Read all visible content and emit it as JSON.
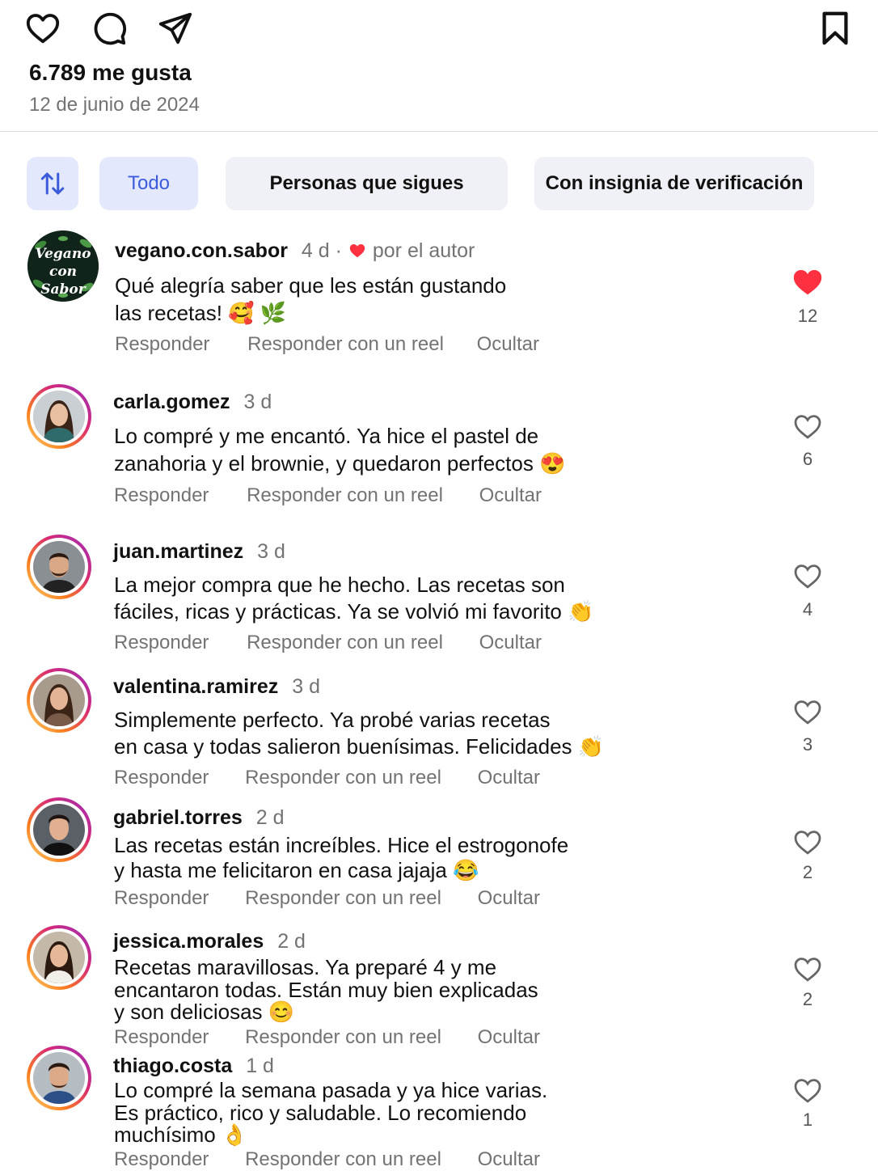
{
  "post": {
    "likes_text": "6.789 me gusta",
    "date_text": "12 de junio de 2024"
  },
  "icons": {
    "like": "heart-icon",
    "comment": "comment-icon",
    "share": "send-icon",
    "save": "bookmark-icon",
    "sort": "sort-arrows-icon"
  },
  "filters": [
    {
      "label": "Todo",
      "active": true
    },
    {
      "label": "Personas que sigues",
      "active": false
    },
    {
      "label": "Con insignia de verificación",
      "active": false
    }
  ],
  "action_labels": {
    "reply": "Responder",
    "reply_reel": "Responder con un reel",
    "hide": "Ocultar"
  },
  "colors": {
    "accent": "#3b5bdb",
    "liked_heart": "#ff3040",
    "muted_text": "#737373"
  },
  "comments": [
    {
      "username": "vegano.con.sabor",
      "time": "4 d",
      "author_badge": "por el autor",
      "avatar_text": "Vegano con Sabor",
      "lines": [
        "Qué alegría saber que les están gustando",
        "las recetas! 🥰 🌿"
      ],
      "likes": "12",
      "liked": true
    },
    {
      "username": "carla.gomez",
      "time": "3 d",
      "lines": [
        "Lo compré y me encantó. Ya hice el pastel de",
        "zanahoria y el brownie, y quedaron perfectos 😍"
      ],
      "likes": "6",
      "liked": false
    },
    {
      "username": "juan.martinez",
      "time": "3 d",
      "lines": [
        "La mejor compra que he hecho. Las recetas son",
        "fáciles, ricas y prácticas. Ya se volvió mi favorito 👏"
      ],
      "likes": "4",
      "liked": false
    },
    {
      "username": "valentina.ramirez",
      "time": "3 d",
      "lines": [
        "Simplemente perfecto. Ya probé varias recetas",
        "en casa y todas salieron buenísimas. Felicidades 👏"
      ],
      "likes": "3",
      "liked": false
    },
    {
      "username": "gabriel.torres",
      "time": "2 d",
      "lines": [
        "Las recetas están increíbles. Hice el estrogonofe",
        "y hasta me felicitaron en casa jajaja 😂"
      ],
      "likes": "2",
      "liked": false
    },
    {
      "username": "jessica.morales",
      "time": "2 d",
      "lines": [
        "Recetas maravillosas. Ya preparé 4 y me",
        "encantaron todas. Están muy bien explicadas",
        "y son deliciosas 😊"
      ],
      "likes": "2",
      "liked": false
    },
    {
      "username": "thiago.costa",
      "time": "1 d",
      "lines": [
        "Lo compré la semana pasada y ya hice varias.",
        "Es práctico, rico y saludable. Lo recomiendo",
        "muchísimo 👌"
      ],
      "likes": "1",
      "liked": false
    }
  ]
}
